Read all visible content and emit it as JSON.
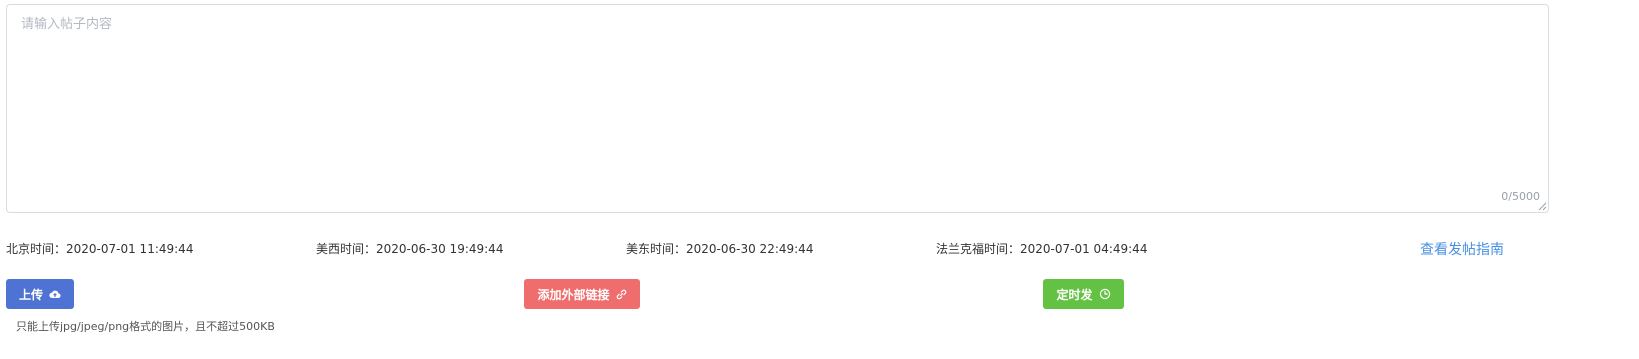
{
  "editor": {
    "placeholder": "请输入帖子内容",
    "value": "",
    "counter": "0/5000"
  },
  "times": {
    "beijing": "北京时间：2020-07-01 11:49:44",
    "us_west": "美西时间：2020-06-30 19:49:44",
    "us_east": "美东时间：2020-06-30 22:49:44",
    "frankfurt": "法兰克福时间：2020-07-01 04:49:44"
  },
  "guide_link": "查看发帖指南",
  "buttons": {
    "upload": "上传",
    "add_link": "添加外部链接",
    "schedule": "定时发"
  },
  "upload_hint": "只能上传jpg/jpeg/png格式的图片，且不超过500KB",
  "icons": {
    "upload": "cloud-upload-icon",
    "add_link": "link-icon",
    "schedule": "clock-icon"
  },
  "colors": {
    "upload": "#4e73d3",
    "add_link": "#f06d6d",
    "schedule": "#63c243",
    "link_text": "#4a90e2"
  }
}
